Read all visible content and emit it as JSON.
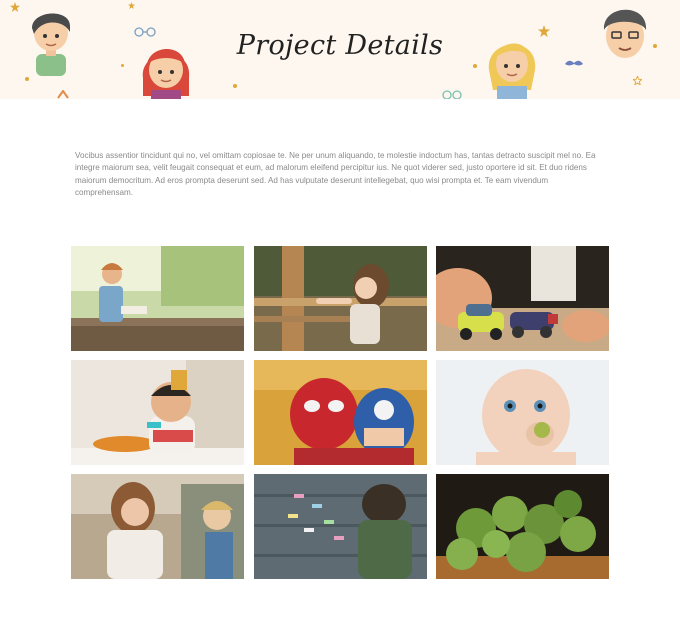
{
  "header": {
    "title": "Project Details"
  },
  "intro": {
    "text": "Vocibus assentior tincidunt qui no, vel omittam copiosae te. Ne per unum aliquando, te molestie indoctum has, tantas detracto suscipit mel no. Ea integre maiorum sea, velit feugait consequat et eum, ad malorum eleifend percipitur ius. Ne quot viderer sed, justo oportere id sit. Et duo ridens maiorum democritum. Ad eros prompta deserunt sed. Ad has vulputate deserunt intellegebat, quo wisi prompta et. Te eam vivendum comprehensam."
  },
  "gallery": {
    "items": [
      {
        "subject": "boy-sitting-on-bench-photo"
      },
      {
        "subject": "girl-on-playground-photo"
      },
      {
        "subject": "toy-cars-photo"
      },
      {
        "subject": "toddler-eating-photo"
      },
      {
        "subject": "kids-superhero-masks-photo"
      },
      {
        "subject": "baby-chewing-photo"
      },
      {
        "subject": "mother-and-child-photo"
      },
      {
        "subject": "child-with-chalk-photo"
      },
      {
        "subject": "brussels-sprouts-photo"
      }
    ]
  },
  "colors": {
    "hero_background": "#fdf7ef",
    "accent_star": "#e0a73a",
    "title": "#222222",
    "body_text": "#8a8a8a"
  }
}
